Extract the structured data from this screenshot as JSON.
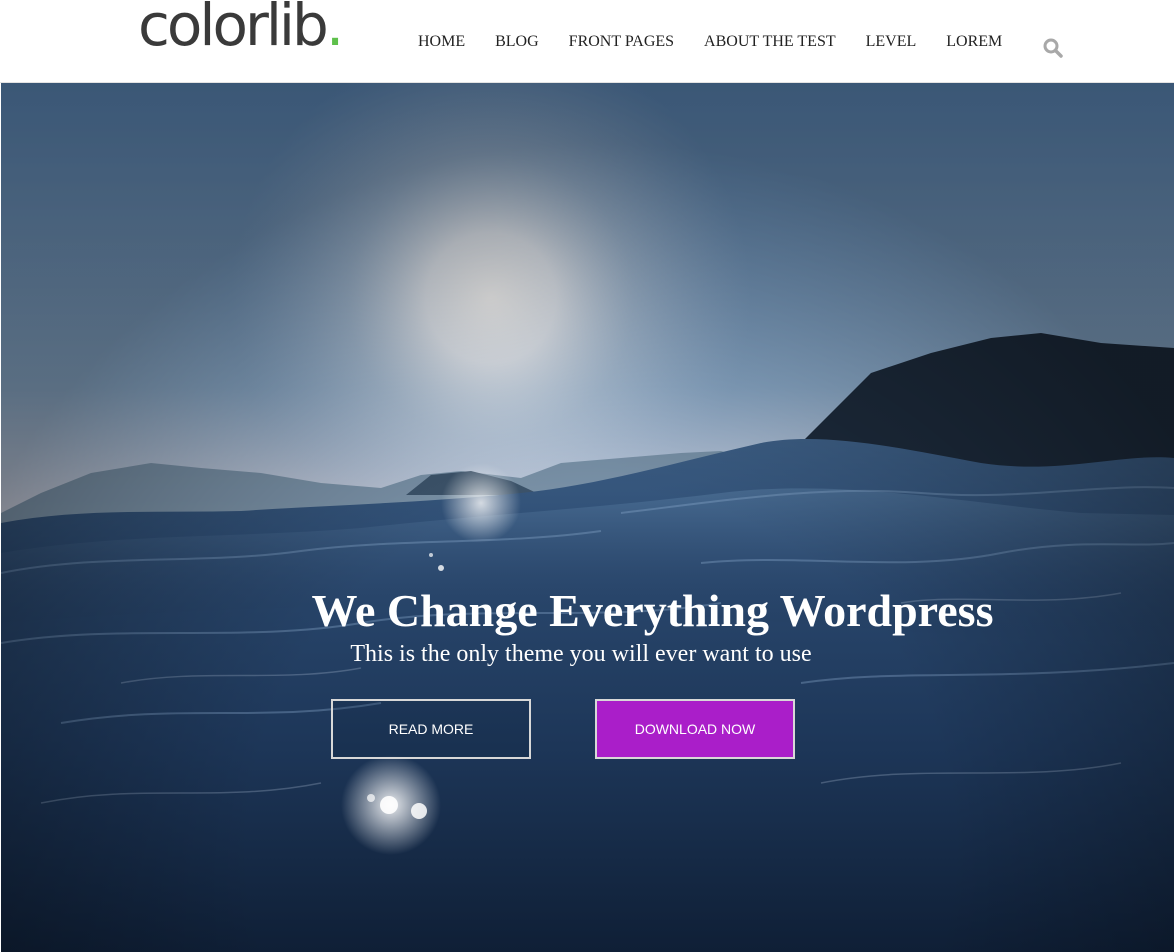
{
  "header": {
    "logo_text": "colorlib",
    "logo_dot": ".",
    "logo_dot_color": "#5ec04b",
    "search_icon": "search-icon"
  },
  "nav": {
    "items": [
      {
        "label": "HOME"
      },
      {
        "label": "BLOG"
      },
      {
        "label": "FRONT PAGES"
      },
      {
        "label": "ABOUT THE TEST"
      },
      {
        "label": "LEVEL"
      },
      {
        "label": "LOREM"
      }
    ]
  },
  "hero": {
    "title": "We Change Everything Wordpress",
    "subtitle": "This is the only theme you will ever want to use",
    "read_more_label": "READ MORE",
    "download_label": "DOWNLOAD NOW",
    "accent_color": "#aa1ec9"
  }
}
